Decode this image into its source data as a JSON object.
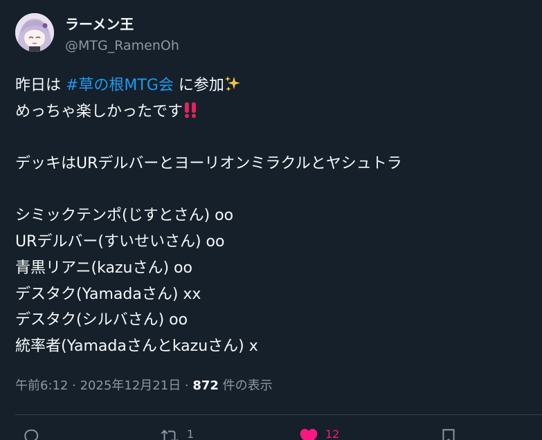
{
  "author": {
    "display_name": "ラーメン王",
    "handle": "@MTG_RamenOh",
    "avatar_icon": "anime-avatar-icon"
  },
  "tweet": {
    "line1": {
      "pre": "昨日は ",
      "hashtag": "#草の根MTG会",
      "post": " に参加"
    },
    "line2": "めっちゃ楽しかったです",
    "line4": "デッキはURデルバーとヨーリオンミラクルとヤシュトラ",
    "results": [
      "シミックテンポ(じすとさん) oo",
      "URデルバー(すいせいさん) oo",
      "青黒リアニ(kazuさん) oo",
      "デスタク(Yamadaさん) xx",
      "デスタク(シルバさん) oo",
      "統率者(Yamadaさんとkazuさん) x"
    ]
  },
  "meta": {
    "time_date": "午前6:12 · 2025年12月21日 · ",
    "views_count": "872",
    "views_label": " 件の表示"
  },
  "actions": {
    "reply_count": "",
    "retweet_count": "1",
    "like_count": "12",
    "bookmark_count": ""
  },
  "colors": {
    "background": "#15202b",
    "hashtag": "#1d9bf0",
    "secondary_text": "#8b98a5",
    "like": "#f91880"
  }
}
